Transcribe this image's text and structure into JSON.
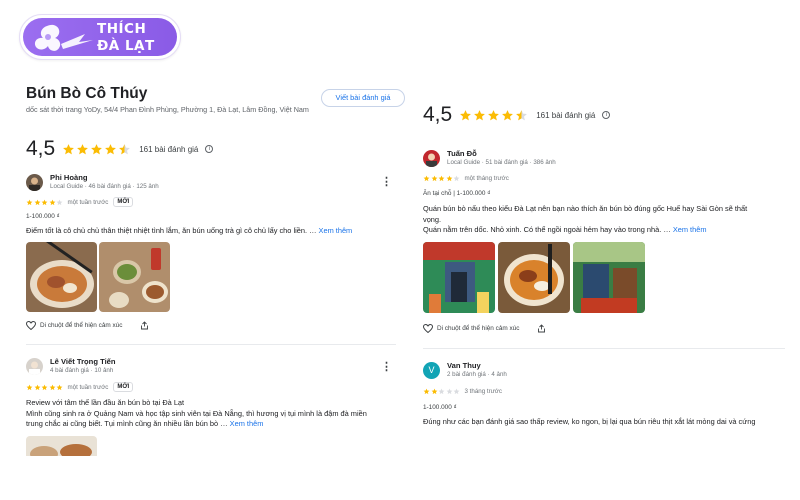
{
  "logo": {
    "line1": "THÍCH",
    "line2": "ĐÀ LẠT"
  },
  "place": {
    "title": "Bún Bò Cô Thúy",
    "address": "dốc sát thời trang YoDy, 54/4 Phan Đình Phùng, Phường 1, Đà Lạt, Lâm Đồng, Việt Nam",
    "write_review_label": "Viết bài đánh giá"
  },
  "summary_left": {
    "rating": "4,5",
    "stars": 4.5,
    "count": "161 bài đánh giá"
  },
  "summary_right": {
    "rating": "4,5",
    "stars": 4.5,
    "count": "161 bài đánh giá"
  },
  "colors": {
    "star": "#fbbc04",
    "star_empty": "#dadce0",
    "link": "#1a73e8",
    "logo": "#8a5be6"
  },
  "reviews_left": [
    {
      "name": "Phi Hoàng",
      "meta": "Local Guide · 46 bài đánh giá · 125 ảnh",
      "stars": 4,
      "when": "một tuần trước",
      "badge": "MỚI",
      "price": "1-100.000 ₫",
      "text": "Điểm tốt là cô chủ chủ thân thiệt nhiệt tình lắm, ăn bún uống trà gì cô chủ lấy cho liền. …",
      "more": "Xem thêm",
      "react": "Di chuột để thể hiện cảm xúc"
    },
    {
      "name": "Lê Viết Trọng Tiến",
      "meta": "4 bài đánh giá · 10 ảnh",
      "stars": 5,
      "when": "một tuần trước",
      "badge": "MỚI",
      "line1": "Review với tâm thế lần đầu ăn bún bò tại Đà Lạt",
      "line2": "Mình cũng sinh ra ở Quảng Nam và học tập sinh viên tại Đà Nẵng, thì hương vị tụi mình là đậm đà miền",
      "line3": "trung chắc ai cũng biết. Tụi mình cũng ăn nhiều lần bún bò …",
      "more": "Xem thêm"
    }
  ],
  "reviews_right": [
    {
      "name": "Tuấn Đỗ",
      "meta": "Local Guide · 51 bài đánh giá · 386 ảnh",
      "stars": 4,
      "when": "một tháng trước",
      "tags": "Ăn tại chỗ  |  1-100.000 ₫",
      "line1": "Quán bún bò nấu theo kiểu Đà Lạt nên bạn nào thích ăn bún bò đúng gốc Huế hay Sài Gòn sẽ thất",
      "line2": "vọng.",
      "line3": "Quán nằm trên dốc. Nhỏ xinh. Có thể ngồi ngoài hẻm hay vào trong nhà. …",
      "more": "Xem thêm",
      "react": "Di chuột để thể hiện cảm xúc"
    },
    {
      "name": "Van Thuy",
      "avatar_letter": "V",
      "meta": "2 bài đánh giá · 4 ảnh",
      "stars": 2,
      "when": "3 tháng trước",
      "price": "1-100.000 ₫",
      "text": "Đúng như các bạn đánh giá sao thấp review, ko ngon, bị lại qua bún riêu thịt xắt lát mỏng dai và cứng"
    }
  ]
}
